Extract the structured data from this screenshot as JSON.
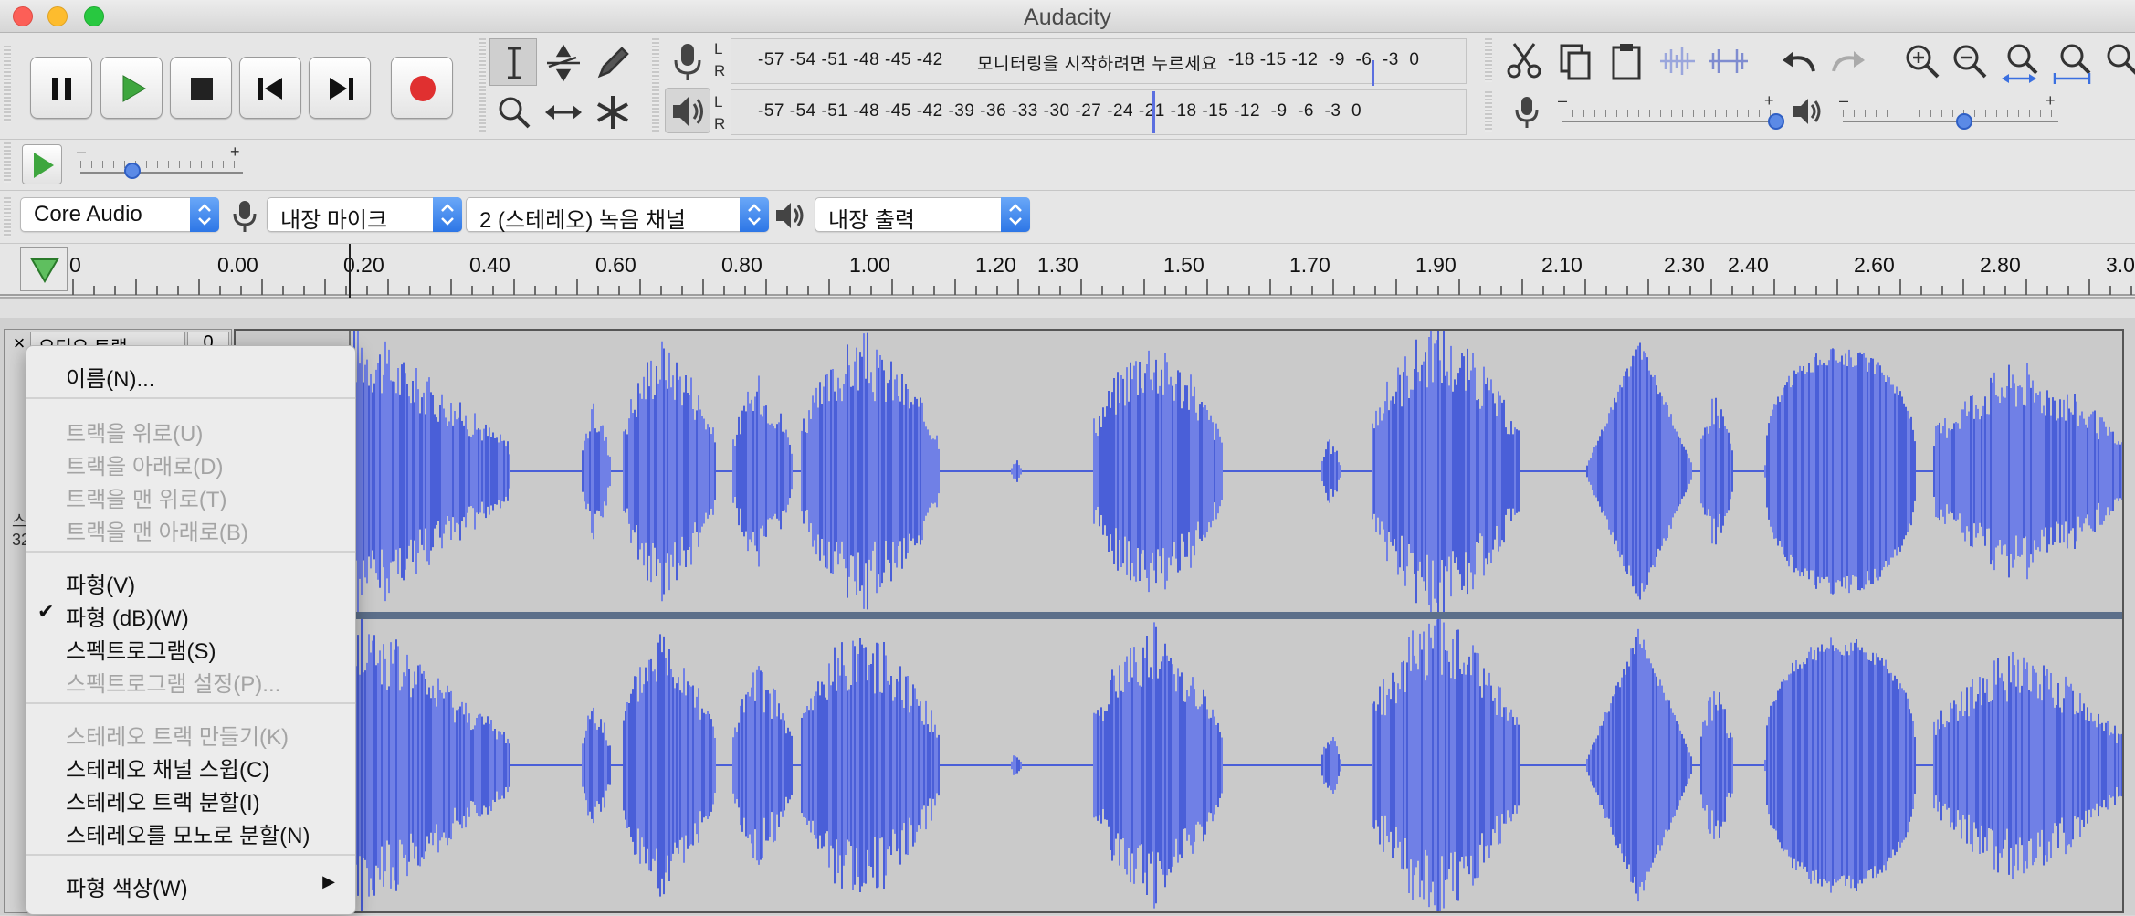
{
  "window": {
    "title": "Audacity"
  },
  "meters": {
    "record_scale": "-57 -54 -51 -48 -45 -42",
    "record_prompt": "모니터링을 시작하려면 누르세요",
    "record_scale_right": "-18 -15 -12  -9  -6  -3  0",
    "playback_scale": "-57 -54 -51 -48 -45 -42 -39 -36 -33 -30 -27 -24 -21 -18 -15 -12  -9  -6  -3  0",
    "left_channel": "L",
    "right_channel": "R"
  },
  "sliders": {
    "minus": "–",
    "plus": "+"
  },
  "devices": {
    "host": "Core Audio",
    "recording_device": "내장 마이크",
    "recording_channels": "2 (스테레오) 녹음 채널",
    "playback_device": "내장 출력"
  },
  "timeline": {
    "labels": [
      "0",
      "0.00",
      "0.20",
      "0.40",
      "0.60",
      "0.80",
      "1.00",
      "1.20",
      "1.30",
      "1.50",
      "1.70",
      "1.90",
      "2.10",
      "2.30",
      "2.40",
      "2.60",
      "2.80",
      "3.00"
    ]
  },
  "track": {
    "name": "오디오 트랙",
    "close": "×",
    "gain": "0",
    "partial_label_1": "스",
    "partial_label_2": "32"
  },
  "context_menu": {
    "items": [
      {
        "label": "이름(N)...",
        "enabled": true
      },
      {
        "label": "트랙을 위로(U)",
        "enabled": false
      },
      {
        "label": "트랙을 아래로(D)",
        "enabled": false
      },
      {
        "label": "트랙을 맨 위로(T)",
        "enabled": false
      },
      {
        "label": "트랙을 맨 아래로(B)",
        "enabled": false
      },
      {
        "label": "파형(V)",
        "enabled": true
      },
      {
        "label": "파형 (dB)(W)",
        "enabled": true,
        "checked": true,
        "check_mark": "✔"
      },
      {
        "label": "스펙트로그램(S)",
        "enabled": true
      },
      {
        "label": "스펙트로그램 설정(P)...",
        "enabled": false
      },
      {
        "label": "스테레오 트랙 만들기(K)",
        "enabled": false
      },
      {
        "label": "스테레오 채널 스윕(C)",
        "enabled": true
      },
      {
        "label": "스테레오 트랙 분할(I)",
        "enabled": true
      },
      {
        "label": "스테레오를 모노로 분할(N)",
        "enabled": true
      },
      {
        "label": "파형 색상(W)",
        "enabled": true,
        "submenu_arrow": "▶"
      }
    ]
  },
  "colors": {
    "waveform": "#4a5fd8",
    "waveform_light": "#7080e6",
    "accent": "#2d76e6"
  }
}
